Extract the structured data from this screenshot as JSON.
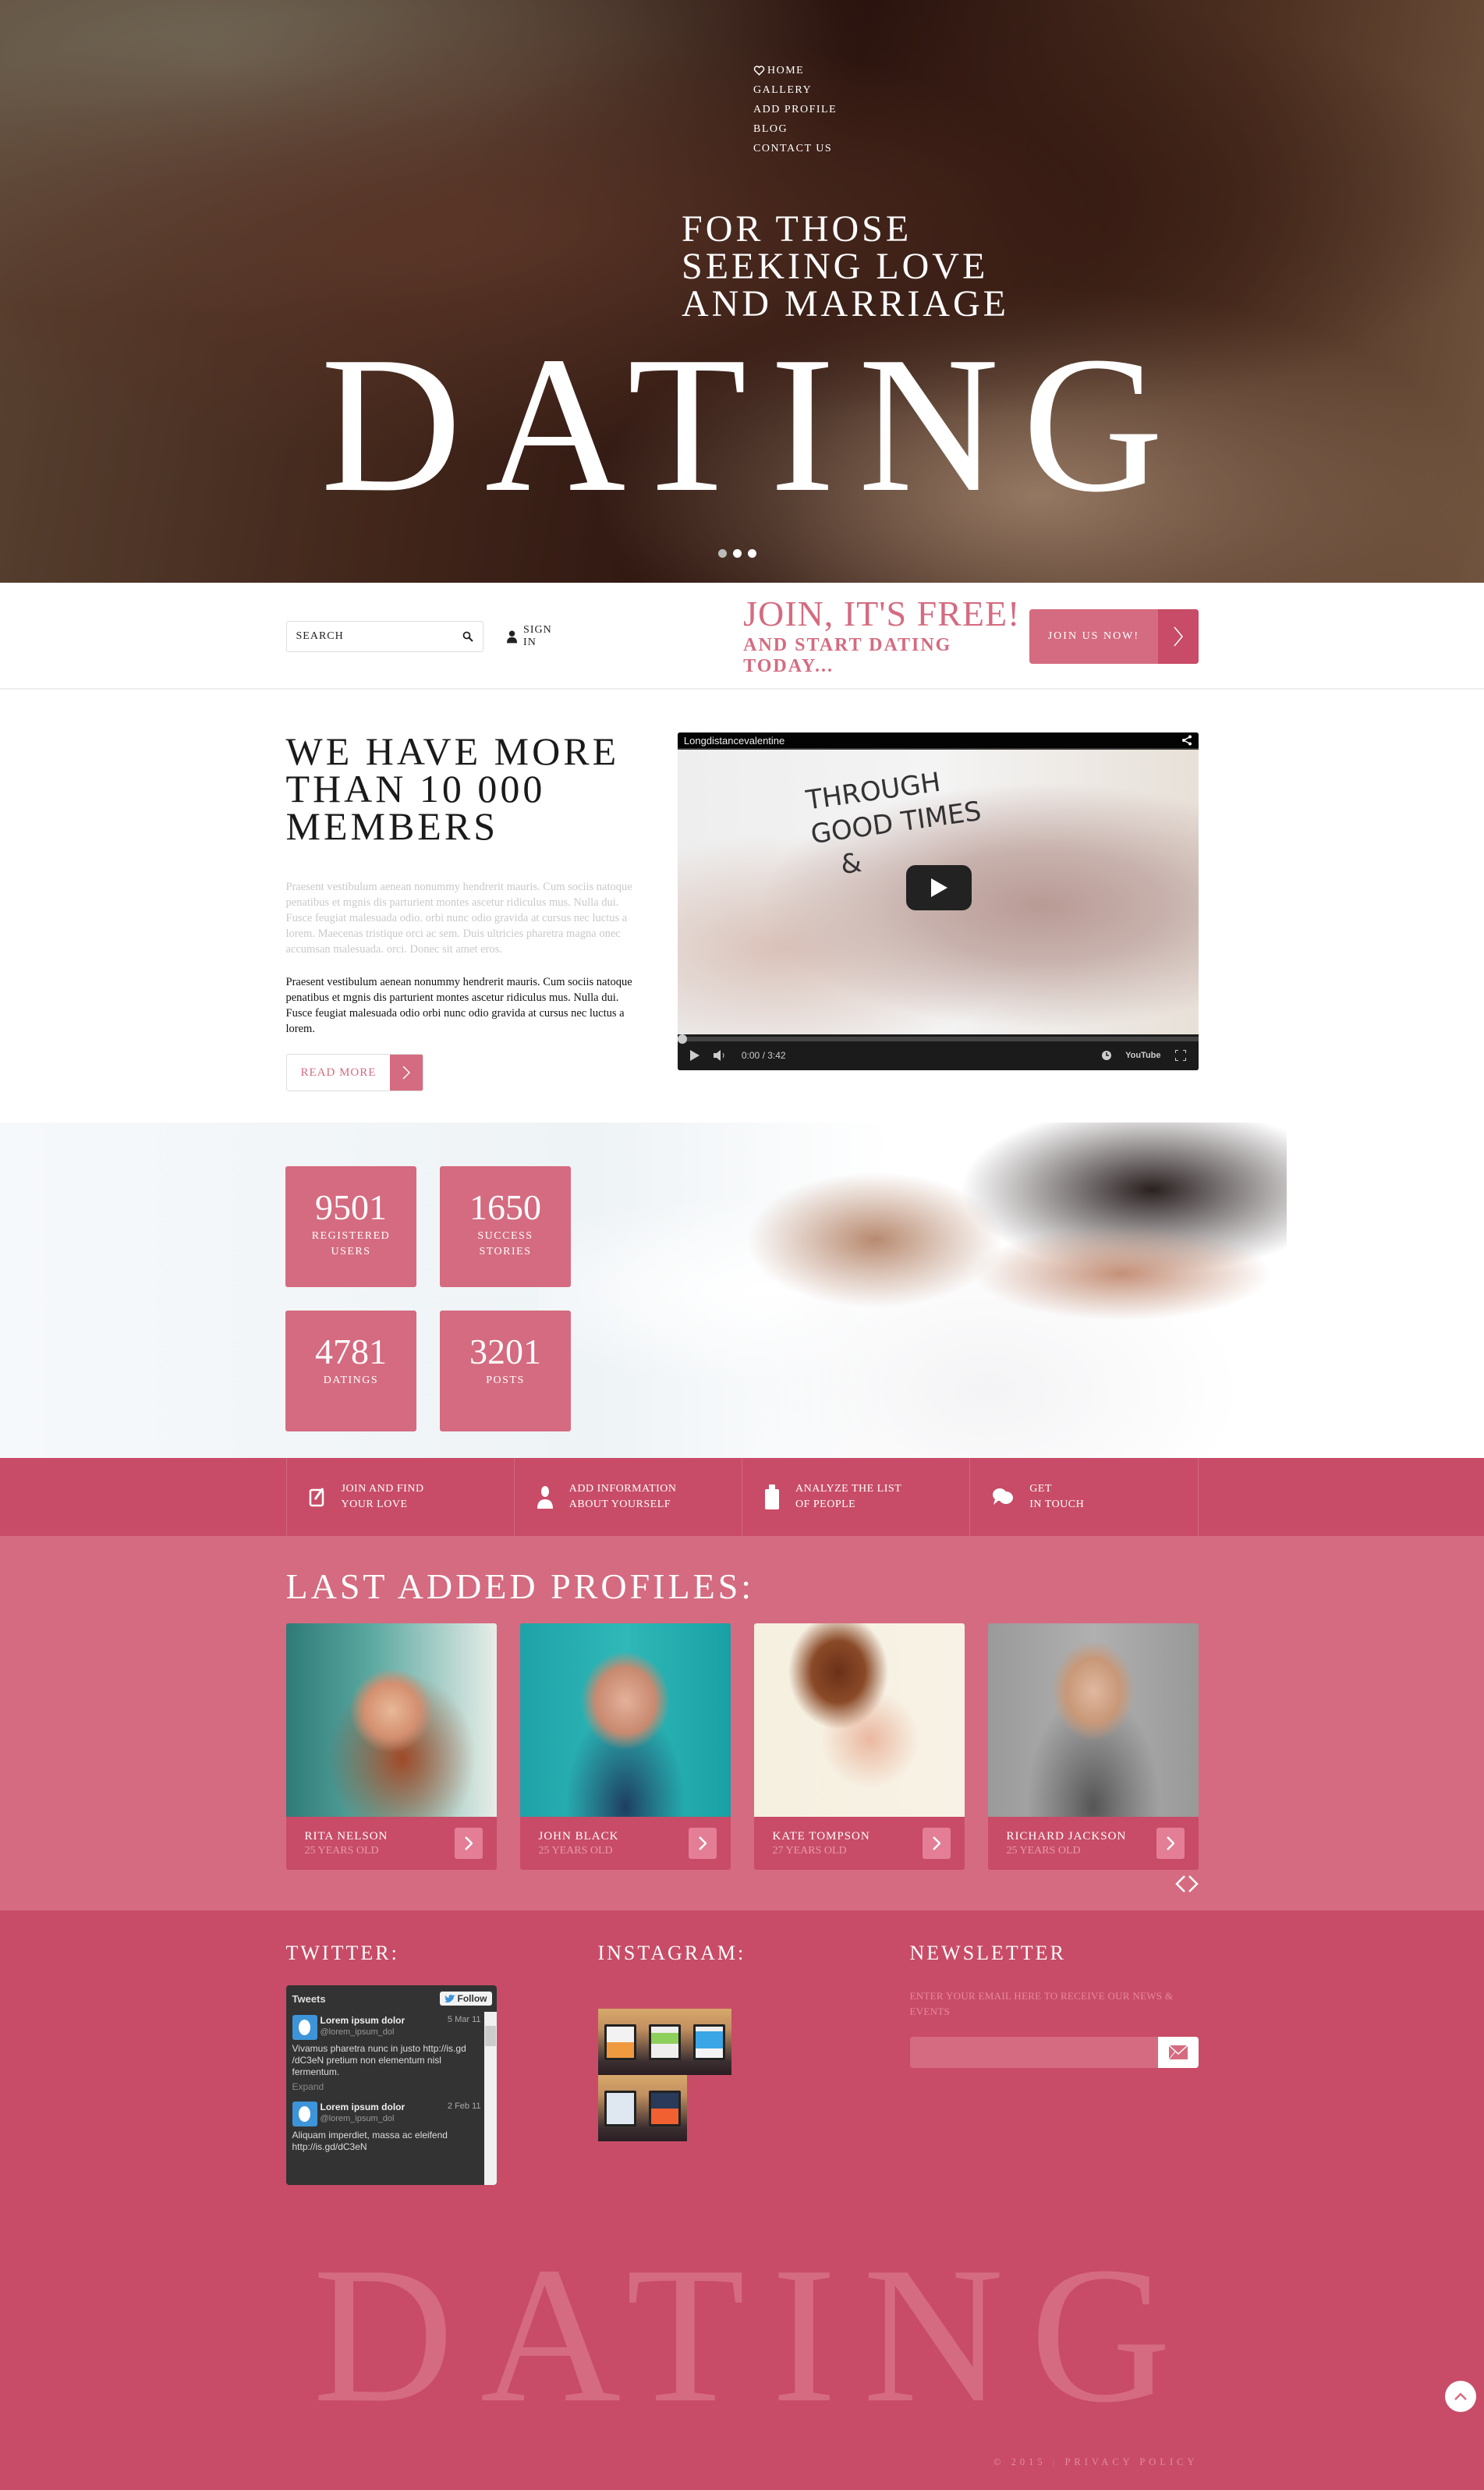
{
  "nav": {
    "items": [
      {
        "label": "HOME",
        "icon": "heart-icon"
      },
      {
        "label": "GALLERY"
      },
      {
        "label": "ADD PROFILE"
      },
      {
        "label": "BLOG"
      },
      {
        "label": "CONTACT US"
      }
    ]
  },
  "hero": {
    "tagline": [
      "FOR THOSE",
      "SEEKING LOVE",
      "AND MARRIAGE"
    ],
    "title": "DATING",
    "slides": {
      "count": 3,
      "active": 1
    }
  },
  "bar": {
    "search_placeholder": "SEARCH",
    "signin_label": "SIGN IN",
    "join_title": "JOIN, IT'S FREE!",
    "join_subtitle": "AND START DATING TODAY...",
    "join_button": "JOIN US NOW!"
  },
  "about": {
    "heading": "WE HAVE MORE THAN 10 000 MEMBERS",
    "paragraph_muted": "Praesent vestibulum aenean nonummy hendrerit mauris. Cum sociis natoque penatibus et mgnis dis parturient montes ascetur ridiculus mus. Nulla dui. Fusce feugiat malesuada odio. orbi nunc odio gravida at cursus nec luctus a lorem. Maecenas tristique orci ac sem. Duis ultricies pharetra magna onec accumsan malesuada. orci. Donec sit amet eros.",
    "paragraph": "Praesent vestibulum aenean nonummy hendrerit mauris. Cum sociis natoque penatibus et mgnis dis parturient montes ascetur ridiculus mus. Nulla dui. Fusce feugiat malesuada odio orbi nunc odio gravida at cursus nec luctus a lorem.",
    "read_more": "READ MORE"
  },
  "video": {
    "title": "Longdistancevalentine",
    "scribble": "THROUGH\nGOOD TIMES\n&",
    "time_current": "0:00",
    "time_total": "3:42",
    "time_display": "0:00 / 3:42",
    "progress": 0,
    "brand": "YouTube"
  },
  "stats": [
    {
      "value": "9501",
      "label": "REGISTERED\nUSERS"
    },
    {
      "value": "1650",
      "label": "SUCCESS\nSTORIES"
    },
    {
      "value": "4781",
      "label": "DATINGS"
    },
    {
      "value": "3201",
      "label": "POSTS"
    }
  ],
  "features": [
    {
      "icon": "edit-icon",
      "label": "JOIN AND FIND\nYOUR LOVE"
    },
    {
      "icon": "user-icon",
      "label": "ADD INFORMATION\nABOUT YOURSELF"
    },
    {
      "icon": "clipboard-icon",
      "label": "ANALYZE THE LIST\nOF PEOPLE"
    },
    {
      "icon": "chat-icon",
      "label": "GET\nIN TOUCH"
    }
  ],
  "profiles": {
    "heading": "LAST ADDED PROFILES:",
    "items": [
      {
        "name": "RITA NELSON",
        "age": "25 YEARS OLD"
      },
      {
        "name": "JOHN BLACK",
        "age": "25 YEARS OLD"
      },
      {
        "name": "KATE TOMPSON",
        "age": "27 YEARS OLD"
      },
      {
        "name": "RICHARD JACKSON",
        "age": "25 YEARS OLD"
      }
    ]
  },
  "footer": {
    "twitter_heading": "TWITTER:",
    "twitter": {
      "title": "Tweets",
      "follow": "Follow",
      "tweets": [
        {
          "name": "Lorem ipsum dolor",
          "handle": "@lorem_ipsum_dol",
          "date": "5 Mar 11",
          "text": "Vivamus pharetra nunc in justo http://is.gd /dC3eN pretium non elementum nisl fermentum.",
          "expand": "Expand"
        },
        {
          "name": "Lorem ipsum dolor",
          "handle": "@lorem_ipsum_dol",
          "date": "2 Feb 11",
          "text": "Aliquam imperdiet, massa ac eleifend http://is.gd/dC3eN"
        }
      ]
    },
    "instagram_heading": "INSTAGRAM:",
    "newsletter_heading": "NEWSLETTER",
    "newsletter_text": "ENTER YOUR EMAIL HERE TO RECEIVE OUR NEWS & EVENTS",
    "newsletter_value": "",
    "big_title": "DATING",
    "copyright": "© 2015",
    "privacy": "PRIVACY POLICY"
  },
  "colors": {
    "accent": "#d56b80",
    "accent_dark": "#c84c67",
    "accent_light": "#e47e96"
  }
}
